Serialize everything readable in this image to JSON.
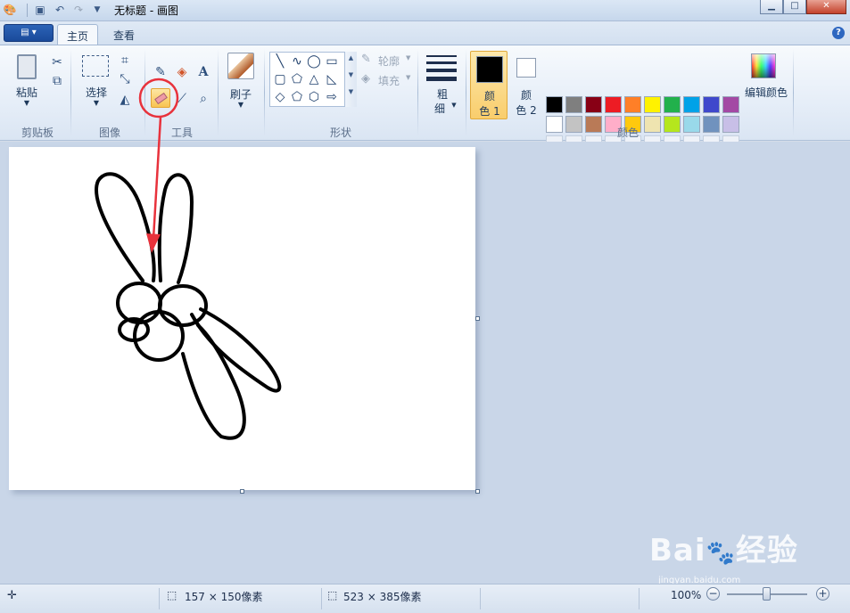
{
  "window": {
    "title": "无标题 - 画图",
    "minimize_icon": "minimize-icon",
    "maximize_icon": "maximize-icon",
    "close_icon": "close-icon"
  },
  "quick_access": [
    "paint-app-icon",
    "save-icon",
    "undo-icon",
    "redo-icon",
    "customize-dropdown-icon"
  ],
  "tabs": [
    {
      "label": "主页",
      "active": true
    },
    {
      "label": "查看",
      "active": false
    }
  ],
  "ribbon": {
    "clipboard": {
      "paste_label": "粘贴",
      "group_label": "剪贴板"
    },
    "image": {
      "select_label": "选择",
      "group_label": "图像"
    },
    "tools": {
      "group_label": "工具",
      "selected_tool": "eraser"
    },
    "brushes": {
      "label": "刷子"
    },
    "shapes": {
      "outline_label": "轮廓",
      "fill_label": "填充",
      "group_label": "形状"
    },
    "size": {
      "label_line1": "粗",
      "label_line2": "细"
    },
    "colors": {
      "color1_label_1": "颜",
      "color1_label_2": "色 1",
      "color2_label_1": "颜",
      "color2_label_2": "色 2",
      "color1_value": "#000000",
      "color2_value": "#ffffff",
      "edit_colors_label": "编辑颜色",
      "group_label": "颜色",
      "palette_row1": [
        "#000000",
        "#7f7f7f",
        "#880015",
        "#ed1c24",
        "#ff7f27",
        "#fff200",
        "#22b14c",
        "#00a2e8",
        "#3f48cc",
        "#a349a4"
      ],
      "palette_row2": [
        "#ffffff",
        "#c3c3c3",
        "#b97a57",
        "#ffaec9",
        "#ffc90e",
        "#efe4b0",
        "#b5e61d",
        "#99d9ea",
        "#7092be",
        "#c8bfe7"
      ]
    }
  },
  "status": {
    "selection_size": "157 × 150像素",
    "canvas_size": "523 × 385像素",
    "zoom": "100%"
  },
  "annotation_color": "#e8323c",
  "watermark": {
    "brand": "Bai",
    "brand_tail": "经验",
    "sub": "jingyan.baidu.com"
  }
}
